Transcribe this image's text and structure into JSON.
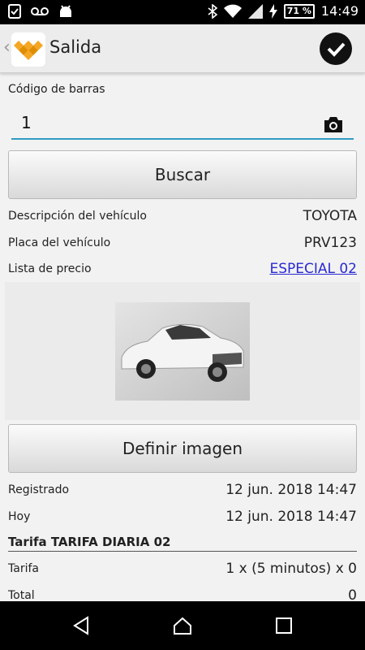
{
  "status_bar": {
    "battery": "71 %",
    "time": "14:49"
  },
  "app_bar": {
    "title": "Salida"
  },
  "barcode": {
    "label": "Código de barras",
    "value": "1"
  },
  "search_button": "Buscar",
  "vehicle": {
    "description_label": "Descripción del vehículo",
    "description_value": "TOYOTA",
    "plate_label": "Placa del vehículo",
    "plate_value": "PRV123",
    "price_list_label": "Lista de precio",
    "price_list_value": "ESPECIAL 02"
  },
  "define_image_button": "Definir imagen",
  "times": {
    "registered_label": "Registrado",
    "registered_value": "12 jun. 2018 14:47",
    "today_label": "Hoy",
    "today_value": "12 jun. 2018 14:47"
  },
  "tariff": {
    "heading": "Tarifa TARIFA DIARIA 02",
    "rate_label": "Tarifa",
    "rate_value": "1 x (5 minutos) x 0",
    "total_label": "Total",
    "total_value": "0"
  },
  "colors": {
    "accent": "#2e9cc2",
    "link": "#2a2ad4",
    "logo": "#f5a623"
  },
  "icons": [
    "voicemail-icon",
    "android-icon",
    "bluetooth-icon",
    "wifi-icon",
    "signal-icon",
    "battery-icon",
    "back-chevron-icon",
    "app-logo-icon",
    "check-circle-icon",
    "camera-icon",
    "nav-back-icon",
    "nav-home-icon",
    "nav-recents-icon"
  ]
}
